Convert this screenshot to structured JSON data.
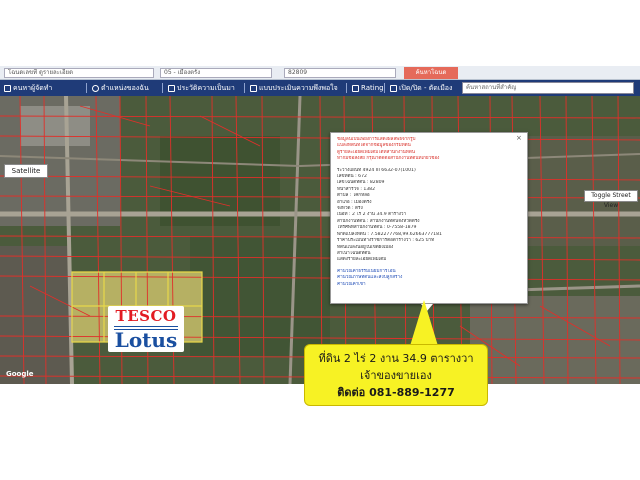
{
  "searchbar": {
    "field1": "โฉนดเลขที่ ดูรายละเอียด",
    "field2": "05 - เมืองตรัง",
    "field3": "82809",
    "search_label": "ค้นหาโฉนด"
  },
  "nav": {
    "items": [
      "คนหาผู้จัดทำ",
      "ตำแหน่งของฉัน",
      "ประวัติความเป็นมา",
      "แบบประเมินความพึงพอใจ",
      "Rating",
      "เปิด/ปิด - ตัดเมือง"
    ],
    "search_placeholder": "ค้นหาสถานที่สำคัญ"
  },
  "map": {
    "satellite_label": "Satellite",
    "toggle_street_view": "Toggle Street View",
    "zoom_in": "+",
    "zoom_out": "−",
    "google": "Google",
    "tesco": "TESCO",
    "lotus": "Lotus"
  },
  "popup": {
    "header_lines": [
      "ข้อมูลนี้เป็นเพียงการแสดงผลลัพธ์จากรูป",
      "แปลงที่ดินที่ได้จากข้อมูลของกรมที่ดิน",
      "ดูรายละเอียดเพิ่มเติมได้ที่สำนักงานที่ดิน",
      "หากมีข้อสงสัย กรุณาติดต่อสำนักงานที่ดินที่เกี่ยวข้อง"
    ],
    "detail_lines": [
      "ระวางแผนที่ 4924 III 6632-07(1001)",
      "เลขที่ดิน : 672",
      "เลขโฉนดที่ดิน : 82809",
      "หน้าสำรวจ : 1382",
      "ตำบล : โคกหล่อ",
      "อำเภอ : เมืองตรัง",
      "จังหวัด : ตรัง",
      "เนื้อที่ : 2 ไร่ 2 งาน 34.9 ตารางวา",
      "สำนักงานที่ดิน : สำนักงานที่ดินจังหวัดตรัง",
      "โทรศัพท์สำนักงานที่ดิน : 0-7558-1879",
      "พิกัดแปลงที่ดิน : 7.582277768,99.62663777181",
      "ราคาประเมินทางราชการต่อตารางวา : 625 บาท",
      "ที่ดินแปลงนี้อยู่ในเขตผังเมือง",
      "สำเนาโฉนดที่ดิน",
      "แสดงรายละเอียดเพิ่มเติม"
    ],
    "link_lines": [
      "คำนวณค่าธรรมเนียมการโอน",
      "คำนวณภาษีที่ดินและสิ่งปลูกสร้าง",
      "คำนวณค่าเช่า"
    ]
  },
  "callout": {
    "line1": "ที่ดิน 2 ไร่ 2 งาน 34.9 ตารางวา",
    "line2": "เจ้าของขายเอง",
    "line3": "ติดต่อ 081-889-1277"
  },
  "colors": {
    "parcel_outline": "#e0302a",
    "nav_bg": "#1f3b78",
    "callout_bg": "#f7f224",
    "tesco_red": "#e21b22",
    "lotus_blue": "#1a4fa0"
  }
}
